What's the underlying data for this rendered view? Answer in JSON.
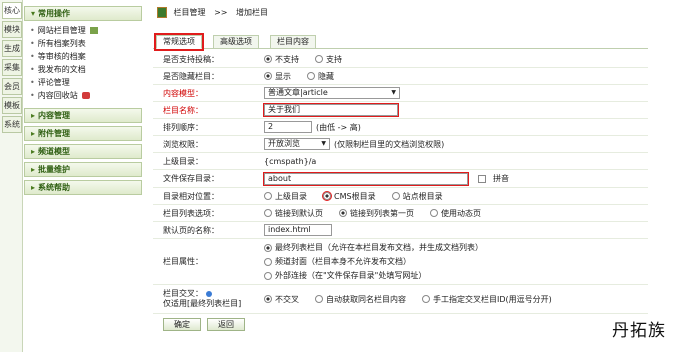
{
  "vtabs": [
    "核心",
    "模块",
    "生成",
    "采集",
    "会员",
    "模板",
    "系统"
  ],
  "sidebar": {
    "sections": [
      {
        "label": "常用操作",
        "items": [
          "网站栏目管理",
          "所有档案列表",
          "等审核的档案",
          "我发布的文档",
          "评论管理",
          "内容回收站"
        ]
      },
      {
        "label": "内容管理"
      },
      {
        "label": "附件管理"
      },
      {
        "label": "频道模型"
      },
      {
        "label": "批量维护"
      },
      {
        "label": "系统帮助"
      }
    ]
  },
  "breadcrumb": {
    "root": "栏目管理",
    "sep": ">>",
    "current": "增加栏目"
  },
  "tabs": [
    "常规选项",
    "高级选项",
    "栏目内容"
  ],
  "form": {
    "support_submit": {
      "label": "是否支持投稿：",
      "opts": [
        "不支持",
        "支持"
      ]
    },
    "hidden_col": {
      "label": "是否隐藏栏目：",
      "opts": [
        "显示",
        "隐藏"
      ]
    },
    "content_model": {
      "label": "内容模型：",
      "value": "普通文章|article"
    },
    "col_name": {
      "label": "栏目名称：",
      "value": "关于我们"
    },
    "sort_order": {
      "label": "排列顺序：",
      "value": "2",
      "hint": "(由低 -> 高)"
    },
    "view_perm": {
      "label": "浏览权限：",
      "value": "开放浏览",
      "hint": "(仅限制栏目里的文档浏览权限)"
    },
    "parent_dir": {
      "label": "上级目录：",
      "value": "{cmspath}/a"
    },
    "save_dir": {
      "label": "文件保存目录：",
      "value": "about",
      "chk": "拼音"
    },
    "dir_pos": {
      "label": "目录相对位置：",
      "opts": [
        "上级目录",
        "CMS根目录",
        "站点根目录"
      ]
    },
    "list_opt": {
      "label": "栏目列表选项：",
      "opts": [
        "链接到默认页",
        "链接到列表第一页",
        "使用动态页"
      ]
    },
    "default_page": {
      "label": "默认页的名称：",
      "value": "index.html"
    },
    "col_attr": {
      "label": "栏目属性：",
      "opts": [
        "最终列表栏目（允许在本栏目发布文档，并生成文档列表）",
        "频道封面（栏目本身不允许发布文档）",
        "外部连接（在\"文件保存目录\"处填写网址）"
      ]
    },
    "cross": {
      "label1": "栏目交叉：",
      "label2": "仅适用[最终列表栏目]",
      "opts": [
        "不交叉",
        "自动获取同名栏目内容",
        "手工指定交叉栏目ID(用逗号分开)"
      ]
    }
  },
  "buttons": {
    "ok": "确定",
    "back": "返回"
  },
  "watermark": "丹拓族"
}
